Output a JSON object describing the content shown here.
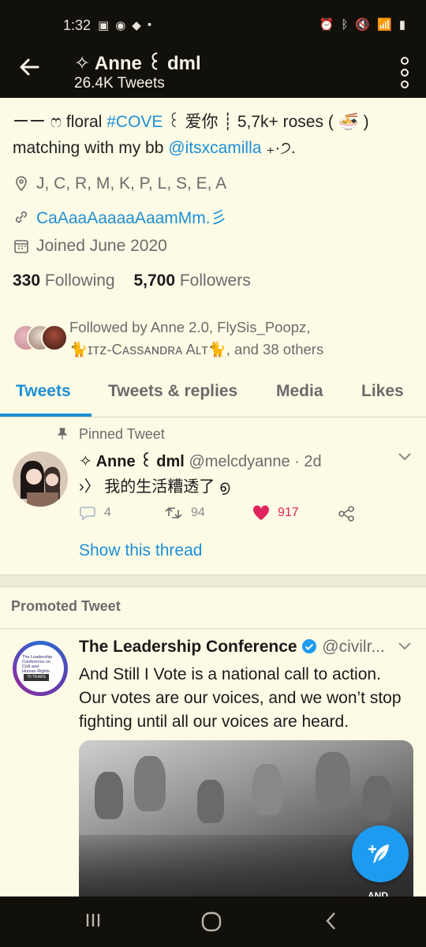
{
  "status_bar": {
    "time": "1:32"
  },
  "header": {
    "profile_name": "✧ Anne ꒰ dml",
    "tweet_count": "26.4K Tweets"
  },
  "bio": {
    "line1_prefix": "ーー ෆ floral ",
    "hashtag": "#COVE",
    "line1_suffix": " ꒰ 爱你 ┊ 5,7k+ roses ( 🍜 )",
    "line2_prefix": "matching with my bb ",
    "mention": "@itsxcamilla",
    "line2_suffix": " ₊·੭."
  },
  "meta": {
    "location": "J, C, R, M, K, P, L, S, E, A",
    "link": "CaAaaAaaaaAaamMm.彡",
    "joined": "Joined June 2020"
  },
  "follow": {
    "following_count": "330",
    "following_label": "Following",
    "followers_count": "5,700",
    "followers_label": "Followers"
  },
  "followed_by": {
    "line1": "Followed by Anne 2.0, FlySis_Poopz,",
    "line2": "🐈ɪᴛᴢ-Cᴀssᴀɴᴅʀᴀ Aʟᴛ🐈, and 38 others"
  },
  "tabs": [
    {
      "label": "Tweets",
      "active": true
    },
    {
      "label": "Tweets & replies",
      "active": false
    },
    {
      "label": "Media",
      "active": false
    },
    {
      "label": "Likes",
      "active": false
    }
  ],
  "pinned_tweet": {
    "pinned_label": "Pinned Tweet",
    "author": "✧ Anne ꒰ dml",
    "handle_time": "@melcdyanne · 2d",
    "text": "›〉 我的生活糟透了 ൭",
    "replies": "4",
    "retweets": "94",
    "likes": "917",
    "show_thread": "Show this thread"
  },
  "promoted": {
    "section_label": "Promoted Tweet",
    "org_name": "The Leadership Conference",
    "handle": "@civilr...",
    "text": "And Still I Vote is a national call to action. Our votes are our voices, and we won’t stop fighting until all our voices are heard.",
    "logo_text": "The Leadership Conference on Civil and Human Rights",
    "logo_years": "70 YEARS",
    "image_overlay": "AND"
  },
  "colors": {
    "accent": "#1d8fd6",
    "like": "#e0245e",
    "background": "#fdfbe6",
    "bars": "#12100b"
  }
}
